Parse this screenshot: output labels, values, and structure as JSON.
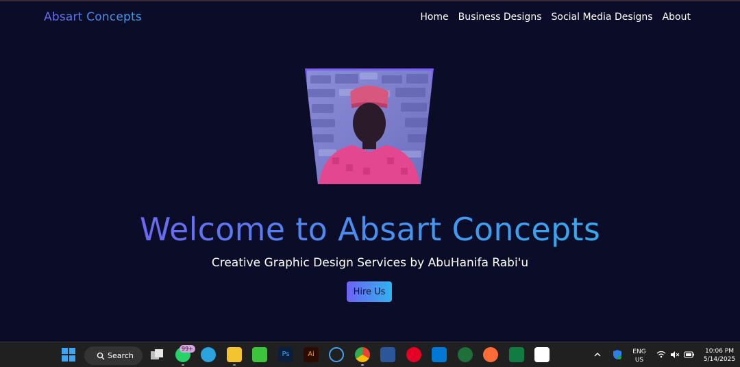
{
  "header": {
    "brand": "Absart Concepts",
    "nav": [
      "Home",
      "Business Designs",
      "Social Media Designs",
      "About"
    ]
  },
  "hero": {
    "title": "Welcome to Absart Concepts",
    "subtitle": "Creative Graphic Design Services by AbuHanifa Rabi'u",
    "cta": "Hire Us"
  },
  "taskbar": {
    "search_label": "Search",
    "whatsapp_badge": "99+",
    "ps_label": "Ps",
    "ai_label": "Ai",
    "lang_top": "ENG",
    "lang_bottom": "US",
    "time": "10:06 PM",
    "date": "5/14/2025"
  },
  "colors": {
    "background": "#0b0c27",
    "gradient_start": "#6b67f0",
    "gradient_end": "#35a6ee"
  }
}
